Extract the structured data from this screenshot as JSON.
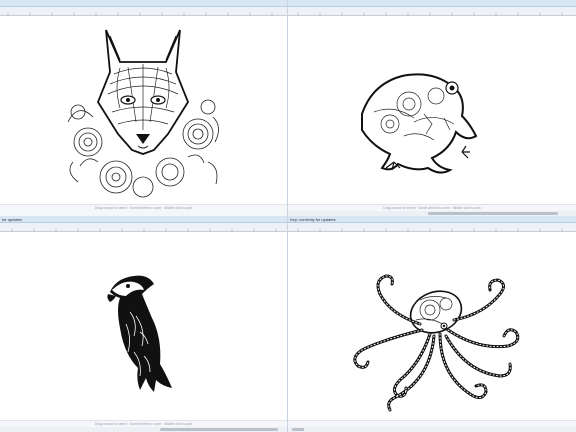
{
  "panes": [
    {
      "id": "wolf",
      "title": "",
      "status": "Drag mouse to select  ·  Scroll wheel to zoom  ·  Middle click to pan"
    },
    {
      "id": "frog",
      "title": "",
      "status": "Drag mouse to select  ·  Scroll wheel to zoom  ·  Middle click to pan"
    },
    {
      "id": "eagle",
      "title": "for updates",
      "status": "Drag mouse to select  ·  Scroll wheel to zoom  ·  Middle click to pan"
    },
    {
      "id": "octopus",
      "title": "Key: currently for updates",
      "status": ""
    }
  ],
  "colors": {
    "titlebar": "#d7e6f4",
    "ruler": "#eef2f7",
    "ink": "#111111"
  },
  "icons": [
    "wolf-illustration",
    "frog-illustration",
    "eagle-illustration",
    "octopus-illustration"
  ]
}
